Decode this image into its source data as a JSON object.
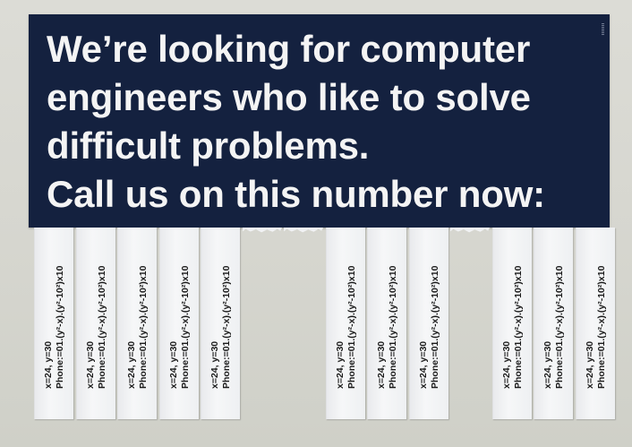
{
  "poster": {
    "headline_lines": [
      "We’re looking for computer",
      "engineers who like to solve",
      "difficult problems.",
      "Call us on this number now:"
    ]
  },
  "tab": {
    "line1": "x=24, y=30",
    "line2": "Phone:=01.(y²-x).(y²-10²)x10"
  },
  "tabs_present": [
    true,
    true,
    true,
    true,
    true,
    false,
    false,
    true,
    true,
    true,
    false,
    true,
    true,
    true
  ],
  "colors": {
    "poster_bg": "#14213f",
    "headline_text": "#f4f4f4",
    "wall": "#d6d6cf",
    "tab_paper": "#f2f3f5"
  }
}
